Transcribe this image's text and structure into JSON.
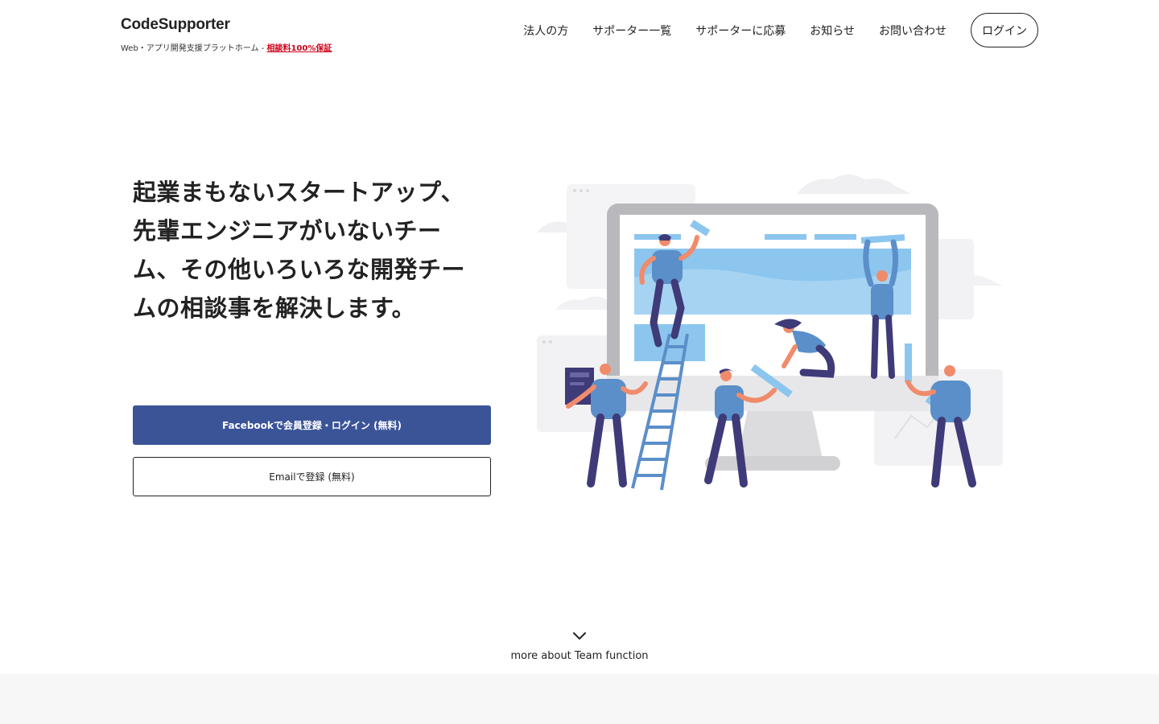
{
  "header": {
    "brand": "CodeSupporter",
    "tagline": "Web・アプリ開発支援プラットホーム - ",
    "tagline_highlight": "相談料100%保証",
    "nav": [
      {
        "label": "法人の方"
      },
      {
        "label": "サポーター一覧"
      },
      {
        "label": "サポーターに応募"
      },
      {
        "label": "お知らせ"
      },
      {
        "label": "お問い合わせ"
      }
    ],
    "login_label": "ログイン"
  },
  "hero": {
    "title": "起業まもないスタートアップ、先輩エンジニアがいないチーム、その他いろいろな開発チームの相談事を解決します。",
    "facebook_button": "Facebookで会員登録・ログイン (無料)",
    "email_button": "Emailで登録 (無料)",
    "illustration_icon": "team-building-website-illustration"
  },
  "more": {
    "label": "more about Team function",
    "icon": "chevron-down-icon"
  },
  "colors": {
    "facebook": "#3b5498",
    "highlight": "#d0021b",
    "person_blue": "#5b8fc9",
    "pants": "#3f3a78",
    "skin": "#f08b6b",
    "screen": "#8cc6ee"
  }
}
